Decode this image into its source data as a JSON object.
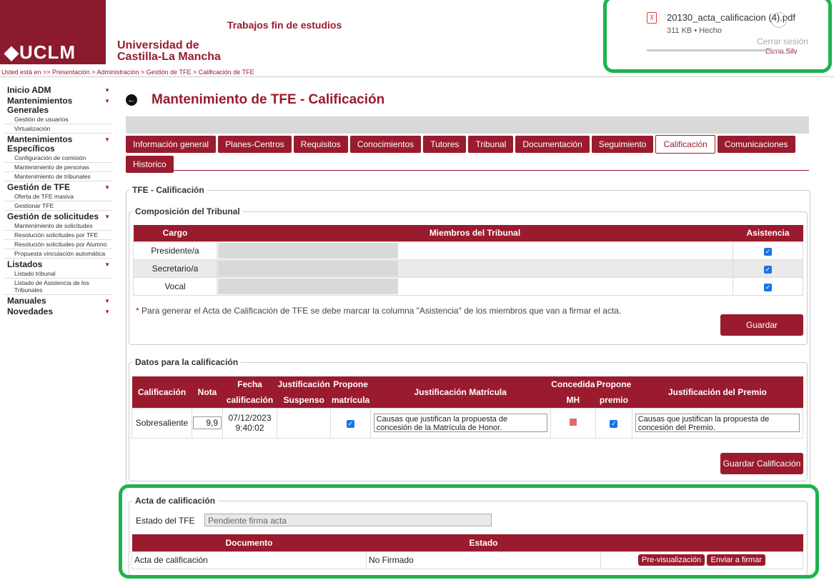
{
  "header": {
    "logo_text": "◆UCLM",
    "university": "Universidad de",
    "university2": "Castilla-La Mancha",
    "app_title": "Trabajos fin de estudios",
    "breadcrumb": "Usted está en >> Presentación > Administración > Gestión de TFE > Calificación de TFE"
  },
  "download": {
    "filename": "20130_acta_calificacion (4).pdf",
    "meta": "311 KB • Hecho",
    "logout": "Cerrar sesión",
    "user": "Elena.Silv"
  },
  "sidebar": {
    "sections": [
      {
        "title": "Inicio ADM",
        "items": []
      },
      {
        "title": "Mantenimientos Generales",
        "items": [
          "Gestión de usuarios",
          "Virtualización"
        ]
      },
      {
        "title": "Mantenimientos Específicos",
        "items": [
          "Configuración de comisión",
          "Mantenimiento de personas",
          "Mantenimiento de tribunales"
        ]
      },
      {
        "title": "Gestión de TFE",
        "items": [
          "Oferta de TFE masiva",
          "Gestionar TFE"
        ]
      },
      {
        "title": "Gestión de solicitudes",
        "items": [
          "Mantenimiento de solicitudes",
          "Resolución solicitudes por TFE",
          "Resolución solicitudes por Alumno",
          "Propuesta vinculación automática"
        ]
      },
      {
        "title": "Listados",
        "items": [
          "Listado tribunal",
          "Listado de Asistencia de los Tribunales"
        ]
      },
      {
        "title": "Manuales",
        "items": []
      },
      {
        "title": "Novedades",
        "items": []
      }
    ]
  },
  "main": {
    "title": "Mantenimiento de TFE - Calificación",
    "tabs": [
      "Información general",
      "Planes-Centros",
      "Requisitos",
      "Conocimientos",
      "Tutores",
      "Tribunal",
      "Documentación",
      "Seguimiento",
      "Calificación",
      "Comunicaciones",
      "Historico"
    ],
    "active_tab": "Calificación",
    "outer_legend": "TFE - Calificación"
  },
  "tribunal": {
    "legend": "Composición del Tribunal",
    "headers": [
      "Cargo",
      "Miembros del Tribunal",
      "Asistencia"
    ],
    "rows": [
      {
        "cargo": "Presidente/a",
        "asistencia": true
      },
      {
        "cargo": "Secretario/a",
        "asistencia": true
      },
      {
        "cargo": "Vocal",
        "asistencia": true
      }
    ],
    "note_star": "*",
    "note": " Para generar el Acta de Calificación de TFE se debe marcar la columna \"Asistencia\" de los miembros que van a firmar el acta.",
    "save": "Guardar"
  },
  "datos": {
    "legend": "Datos para la calificación",
    "headers": {
      "calificacion": "Calificación",
      "nota": "Nota",
      "fecha1": "Fecha",
      "fecha2": "calificación",
      "just_susp1": "Justificación",
      "just_susp2": "Suspenso",
      "propone_mat1": "Propone",
      "propone_mat2": "matrícula",
      "just_mat": "Justificación Matrícula",
      "concedida1": "Concedida",
      "concedida2": "MH",
      "propone_premio1": "Propone",
      "propone_premio2": "premio",
      "just_premio": "Justificación del Premio"
    },
    "row": {
      "calificacion": "Sobresaliente",
      "nota": "9,9",
      "fecha": "07/12/2023",
      "hora": "9:40:02",
      "just_mat": "Causas que justifican la propuesta de concesión de la Matrícula de Honor.",
      "just_premio": "Causas que justifican la propuesta de concesión del Premio."
    },
    "save": "Guardar Calificación"
  },
  "acta": {
    "legend": "Acta de calificación",
    "estado_label": "Estado del TFE",
    "estado_value": "Pendiente firma acta",
    "headers": [
      "Documento",
      "Estado"
    ],
    "row": {
      "documento": "Acta de calificación",
      "estado": "No Firmado"
    },
    "preview": "Pre-visualización",
    "send": "Enviar a firmar"
  },
  "colors": {
    "brand": "#9a1b2e",
    "highlight": "#1db34e"
  }
}
